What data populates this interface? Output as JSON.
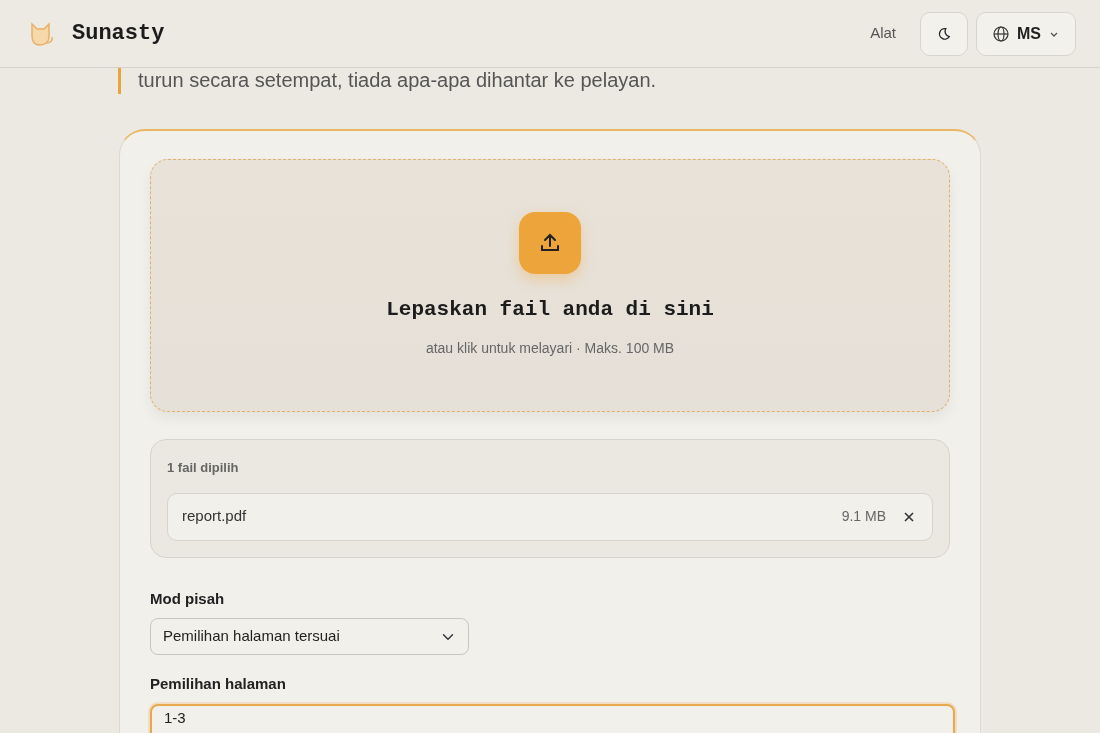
{
  "header": {
    "brand": "Sunasty",
    "nav_link": "Alat",
    "language": "MS"
  },
  "intro": "turun secara setempat, tiada apa-apa dihantar ke pelayan.",
  "dropzone": {
    "title": "Lepaskan fail anda di sini",
    "subtitle": "atau klik untuk melayari · Maks. 100 MB"
  },
  "files": {
    "label": "1 fail dipilih",
    "items": [
      {
        "name": "report.pdf",
        "size": "9.1 MB"
      }
    ]
  },
  "fields": [
    {
      "kind": "select",
      "label": "Mod pisah",
      "value": "Pemilihan halaman tersuai",
      "focused": false
    },
    {
      "kind": "input",
      "label": "Pemilihan halaman",
      "value": "1-3",
      "focused": true
    }
  ]
}
